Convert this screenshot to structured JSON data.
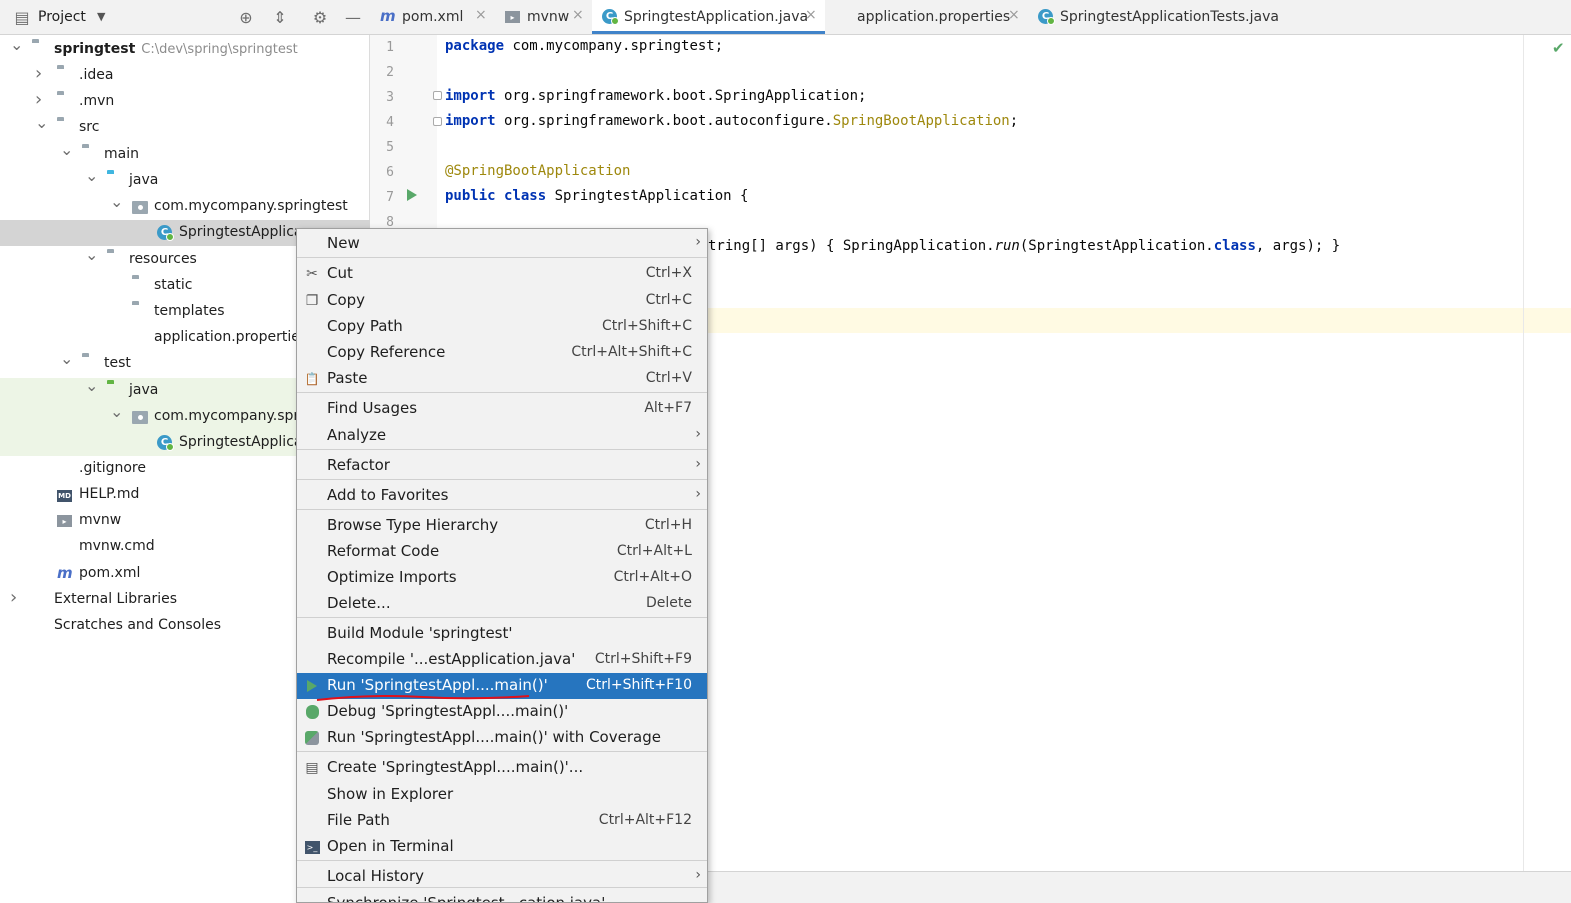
{
  "project_panel": {
    "title": "Project",
    "tree": [
      {
        "label": "springtest",
        "path": "C:\\dev\\spring\\springtest",
        "icon": "module-folder-icon",
        "indent": 0,
        "arrow": "down"
      },
      {
        "label": ".idea",
        "icon": "folder-icon",
        "indent": 1,
        "arrow": "right"
      },
      {
        "label": ".mvn",
        "icon": "folder-icon",
        "indent": 1,
        "arrow": "right"
      },
      {
        "label": "src",
        "icon": "folder-icon",
        "indent": 1,
        "arrow": "down"
      },
      {
        "label": "main",
        "icon": "folder-icon",
        "indent": 2,
        "arrow": "down"
      },
      {
        "label": "java",
        "icon": "source-folder-icon",
        "indent": 3,
        "arrow": "down"
      },
      {
        "label": "com.mycompany.springtest",
        "icon": "package-icon",
        "indent": 4,
        "arrow": "down"
      },
      {
        "label": "SpringtestApplica",
        "icon": "spring-class-icon",
        "indent": 5,
        "arrow": ""
      },
      {
        "label": "resources",
        "icon": "resources-folder-icon",
        "indent": 3,
        "arrow": "down"
      },
      {
        "label": "static",
        "icon": "folder-icon",
        "indent": 4,
        "arrow": ""
      },
      {
        "label": "templates",
        "icon": "folder-icon",
        "indent": 4,
        "arrow": ""
      },
      {
        "label": "application.propertie",
        "icon": "properties-file-icon",
        "indent": 4,
        "arrow": ""
      },
      {
        "label": "test",
        "icon": "folder-icon",
        "indent": 2,
        "arrow": "down"
      },
      {
        "label": "java",
        "icon": "test-folder-icon",
        "indent": 3,
        "arrow": "down"
      },
      {
        "label": "com.mycompany.spri",
        "icon": "package-icon",
        "indent": 4,
        "arrow": "down"
      },
      {
        "label": "SpringtestApplica",
        "icon": "spring-class-icon",
        "indent": 5,
        "arrow": ""
      },
      {
        "label": ".gitignore",
        "icon": "gitignore-file-icon",
        "indent": 1,
        "arrow": ""
      },
      {
        "label": "HELP.md",
        "icon": "markdown-file-icon",
        "indent": 1,
        "arrow": ""
      },
      {
        "label": "mvnw",
        "icon": "shell-file-icon",
        "indent": 1,
        "arrow": ""
      },
      {
        "label": "mvnw.cmd",
        "icon": "text-file-icon",
        "indent": 1,
        "arrow": ""
      },
      {
        "label": "pom.xml",
        "icon": "maven-icon",
        "indent": 1,
        "arrow": ""
      },
      {
        "label": "External Libraries",
        "icon": "libraries-icon",
        "indent": 0,
        "arrow": "right"
      },
      {
        "label": "Scratches and Consoles",
        "icon": "scratches-icon",
        "indent": 0,
        "arrow": ""
      }
    ]
  },
  "tabs": [
    {
      "label": "pom.xml",
      "icon": "maven-icon",
      "active": false
    },
    {
      "label": "mvnw",
      "icon": "shell-file-icon",
      "active": false
    },
    {
      "label": "SpringtestApplication.java",
      "icon": "spring-class-icon",
      "active": true
    },
    {
      "label": "application.properties",
      "icon": "properties-file-icon",
      "active": false
    },
    {
      "label": "SpringtestApplicationTests.java",
      "icon": "spring-class-icon",
      "active": false
    }
  ],
  "editor": {
    "line_numbers": [
      "1",
      "2",
      "3",
      "4",
      "5",
      "6",
      "7",
      "8"
    ],
    "code": {
      "l1_kw": "package",
      "l1_rest": " com.mycompany.springtest;",
      "l3_kw": "import",
      "l3_rest": " org.springframework.boot.SpringApplication;",
      "l4_kw": "import",
      "l4_rest": " org.springframework.boot.autoconfigure.",
      "l4_ann": "SpringBootApplication",
      "l4_end": ";",
      "l6_ann": "@SpringBootApplication",
      "l7_kw": "public class",
      "l7_rest": " SpringtestApplication {",
      "l9_a": "tring[] args) { SpringApplication.",
      "l9_run": "run",
      "l9_b": "(SpringtestApplication.",
      "l9_cls": "class",
      "l9_c": ", args); }"
    }
  },
  "context_menu": {
    "items": [
      {
        "label": "New",
        "shortcut": "",
        "submenu": true,
        "icon": ""
      },
      {
        "label": "Cut",
        "shortcut": "Ctrl+X",
        "submenu": false,
        "icon": "scissors-icon"
      },
      {
        "label": "Copy",
        "shortcut": "Ctrl+C",
        "submenu": false,
        "icon": "copy-icon"
      },
      {
        "label": "Copy Path",
        "shortcut": "Ctrl+Shift+C",
        "submenu": false,
        "icon": ""
      },
      {
        "label": "Copy Reference",
        "shortcut": "Ctrl+Alt+Shift+C",
        "submenu": false,
        "icon": ""
      },
      {
        "label": "Paste",
        "shortcut": "Ctrl+V",
        "submenu": false,
        "icon": "paste-icon"
      },
      {
        "label": "Find Usages",
        "shortcut": "Alt+F7",
        "submenu": false,
        "icon": ""
      },
      {
        "label": "Analyze",
        "shortcut": "",
        "submenu": true,
        "icon": ""
      },
      {
        "label": "Refactor",
        "shortcut": "",
        "submenu": true,
        "icon": ""
      },
      {
        "label": "Add to Favorites",
        "shortcut": "",
        "submenu": true,
        "icon": ""
      },
      {
        "label": "Browse Type Hierarchy",
        "shortcut": "Ctrl+H",
        "submenu": false,
        "icon": ""
      },
      {
        "label": "Reformat Code",
        "shortcut": "Ctrl+Alt+L",
        "submenu": false,
        "icon": ""
      },
      {
        "label": "Optimize Imports",
        "shortcut": "Ctrl+Alt+O",
        "submenu": false,
        "icon": ""
      },
      {
        "label": "Delete...",
        "shortcut": "Delete",
        "submenu": false,
        "icon": ""
      },
      {
        "label": "Build Module 'springtest'",
        "shortcut": "",
        "submenu": false,
        "icon": ""
      },
      {
        "label": "Recompile '...estApplication.java'",
        "shortcut": "Ctrl+Shift+F9",
        "submenu": false,
        "icon": ""
      },
      {
        "label": "Run 'SpringtestAppl....main()'",
        "shortcut": "Ctrl+Shift+F10",
        "submenu": false,
        "icon": "run-icon",
        "highlight": true
      },
      {
        "label": "Debug 'SpringtestAppl....main()'",
        "shortcut": "",
        "submenu": false,
        "icon": "debug-icon"
      },
      {
        "label": "Run 'SpringtestAppl....main()' with Coverage",
        "shortcut": "",
        "submenu": false,
        "icon": "coverage-icon"
      },
      {
        "label": "Create 'SpringtestAppl....main()'...",
        "shortcut": "",
        "submenu": false,
        "icon": "create-config-icon"
      },
      {
        "label": "Show in Explorer",
        "shortcut": "",
        "submenu": false,
        "icon": ""
      },
      {
        "label": "File Path",
        "shortcut": "Ctrl+Alt+F12",
        "submenu": false,
        "icon": ""
      },
      {
        "label": "Open in Terminal",
        "shortcut": "",
        "submenu": false,
        "icon": "terminal-icon"
      },
      {
        "label": "Local History",
        "shortcut": "",
        "submenu": true,
        "icon": ""
      },
      {
        "label": "Synchronize 'Springtest...cation.java'",
        "shortcut": "",
        "submenu": false,
        "icon": ""
      }
    ]
  },
  "colors": {
    "menu_highlight": "#2675bf",
    "keyword": "#0033b3",
    "annotation": "#9e880d",
    "run_green": "#59a869",
    "active_tab_underline": "#4083c9"
  }
}
